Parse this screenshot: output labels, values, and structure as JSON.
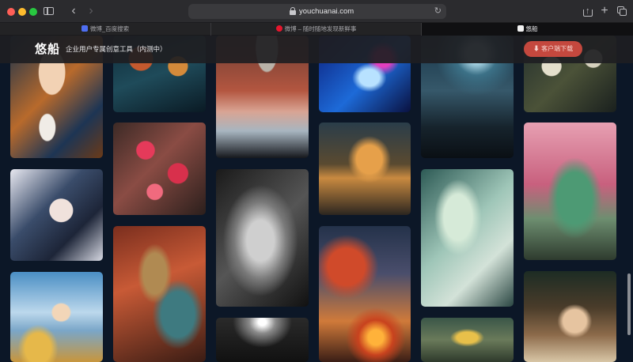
{
  "browser": {
    "url": "youchuanai.com",
    "tabs": [
      {
        "label": "微博_百度搜索",
        "favicon": "baidu-paw-icon",
        "active": false
      },
      {
        "label": "微博 – 随时随地发现新鲜事",
        "favicon": "weibo-icon",
        "active": false
      },
      {
        "label": "悠船",
        "favicon": "youchuan-icon",
        "active": true
      }
    ],
    "icons": {
      "sidebar": "sidebar-icon",
      "back": "chevron-left-icon",
      "forward": "chevron-right-icon",
      "lock": "lock-icon",
      "reload": "reload-icon",
      "share": "share-icon",
      "new_tab": "plus-icon",
      "tab_overview": "tab-overview-icon"
    },
    "glyphs": {
      "back": "‹",
      "forward": "›",
      "reload": "↻",
      "new_tab": "+",
      "share_arrow": "↑"
    }
  },
  "site": {
    "logo": "悠船",
    "tagline": "企业用户专属创意工具（内测中）",
    "download_button": "⬇ 客户端下载",
    "accent_color": "#c4483e"
  },
  "gallery": {
    "columns": 6,
    "items": [
      {
        "column": 1,
        "subject": "girl-offering-buns"
      },
      {
        "column": 1,
        "subject": "anime-boy-portrait"
      },
      {
        "column": 1,
        "subject": "girl-with-birds-sky"
      },
      {
        "column": 2,
        "subject": "ornate-birds"
      },
      {
        "column": 2,
        "subject": "plum-blossoms"
      },
      {
        "column": 2,
        "subject": "woman-with-mask"
      },
      {
        "column": 3,
        "subject": "buddha-canyon"
      },
      {
        "column": 3,
        "subject": "bw-portrait"
      },
      {
        "column": 3,
        "subject": "light-corridor"
      },
      {
        "column": 4,
        "subject": "glowing-hand"
      },
      {
        "column": 4,
        "subject": "futuristic-building"
      },
      {
        "column": 4,
        "subject": "autumn-scene"
      },
      {
        "column": 5,
        "subject": "storm-figure"
      },
      {
        "column": 5,
        "subject": "marble-woman"
      },
      {
        "column": 5,
        "subject": "golden-pagoda"
      },
      {
        "column": 6,
        "subject": "dark-flowers"
      },
      {
        "column": 6,
        "subject": "green-elephant"
      },
      {
        "column": 6,
        "subject": "kungfu-cat"
      }
    ]
  }
}
